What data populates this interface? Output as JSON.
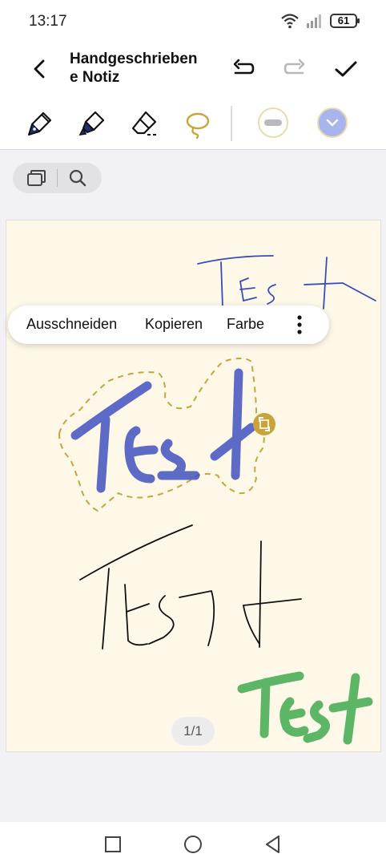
{
  "status_bar": {
    "time": "13:17",
    "battery": "61",
    "icons": [
      "wifi-icon",
      "signal-icon",
      "battery-icon"
    ]
  },
  "header": {
    "title": "Handgeschrieben e Notiz",
    "back_icon": "chevron-left-icon",
    "undo_icon": "undo-icon",
    "redo_icon": "redo-icon",
    "redo_enabled": false,
    "done_icon": "checkmark-icon"
  },
  "toolbar": {
    "tools": [
      "pen-icon",
      "highlighter-icon",
      "eraser-icon",
      "lasso-icon"
    ],
    "active_tool": "lasso-icon",
    "accent_color": "#c9a43a",
    "stroke_width_icon": "minus-icon",
    "color_picker_icon": "chevron-down-icon",
    "color_picker_color": "#a8b4ee"
  },
  "view_controls": {
    "icons": [
      "pages-icon",
      "search-icon"
    ]
  },
  "canvas": {
    "background": "#fdf8e8",
    "selection_color": "#c9a43a",
    "strokes": [
      {
        "text": "Test",
        "color": "#3a4bbf",
        "style": "thin-pen",
        "selected": false
      },
      {
        "text": "Test",
        "color": "#3a4bbf",
        "style": "highlighter",
        "selected": true
      },
      {
        "text": "Test",
        "color": "#111111",
        "style": "thin-pen",
        "selected": false
      },
      {
        "text": "Test",
        "color": "#3aa84a",
        "style": "highlighter",
        "selected": false
      }
    ]
  },
  "context_menu": {
    "items": [
      "Ausschneiden",
      "Kopieren",
      "Farbe"
    ],
    "more_icon": "more-vertical-icon"
  },
  "page_indicator": "1/1",
  "nav_bar": {
    "icons": [
      "recents-square-icon",
      "home-circle-icon",
      "back-triangle-icon"
    ]
  }
}
